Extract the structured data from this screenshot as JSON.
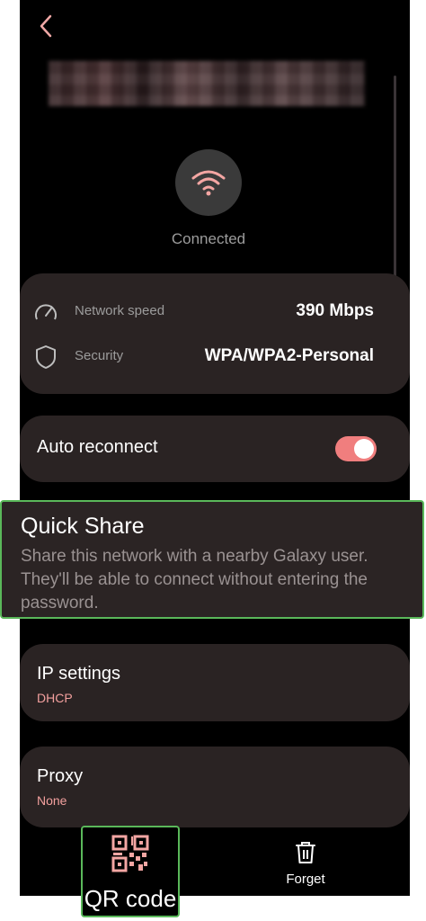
{
  "status": "Connected",
  "details": {
    "network_speed_label": "Network speed",
    "network_speed_value": "390 Mbps",
    "security_label": "Security",
    "security_value": "WPA/WPA2-Personal"
  },
  "auto_reconnect": {
    "label": "Auto reconnect",
    "enabled": true
  },
  "quick_share": {
    "title": "Quick Share",
    "description": "Share this network with a nearby Galaxy user. They'll be able to connect without entering the password."
  },
  "ip_settings": {
    "title": "IP settings",
    "value": "DHCP"
  },
  "proxy": {
    "title": "Proxy",
    "value": "None"
  },
  "bottom_bar": {
    "qr_label": "QR code",
    "forget_label": "Forget"
  },
  "colors": {
    "accent": "#f07e7e",
    "card_bg": "#2a2323",
    "highlight_border": "#5ab85a",
    "subtext": "#f3a09e"
  },
  "icons": {
    "back": "chevron-left-icon",
    "wifi": "wifi-icon",
    "speed": "speedometer-icon",
    "security": "shield-icon",
    "qr": "qr-code-icon",
    "forget": "trash-icon"
  }
}
